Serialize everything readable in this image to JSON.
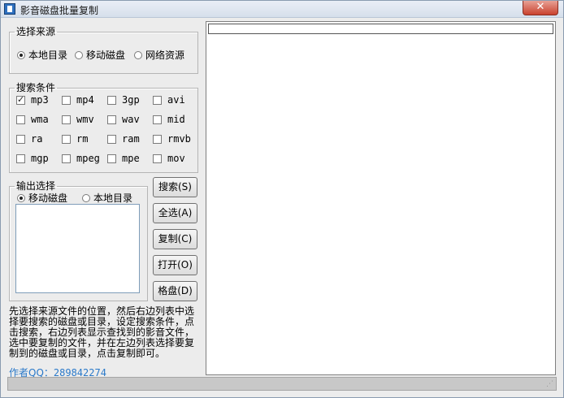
{
  "window": {
    "title": "影音磁盘批量复制",
    "close_glyph": "✕"
  },
  "source_group": {
    "legend": "选择来源",
    "options": [
      {
        "label": "本地目录",
        "selected": true
      },
      {
        "label": "移动磁盘",
        "selected": false
      },
      {
        "label": "网络资源",
        "selected": false
      }
    ]
  },
  "search_group": {
    "legend": "搜索条件",
    "types": [
      {
        "label": "mp3",
        "checked": true
      },
      {
        "label": "mp4",
        "checked": false
      },
      {
        "label": "3gp",
        "checked": false
      },
      {
        "label": "avi",
        "checked": false
      },
      {
        "label": "wma",
        "checked": false
      },
      {
        "label": "wmv",
        "checked": false
      },
      {
        "label": "wav",
        "checked": false
      },
      {
        "label": "mid",
        "checked": false
      },
      {
        "label": "ra",
        "checked": false
      },
      {
        "label": "rm",
        "checked": false
      },
      {
        "label": "ram",
        "checked": false
      },
      {
        "label": "rmvb",
        "checked": false
      },
      {
        "label": "mgp",
        "checked": false
      },
      {
        "label": "mpeg",
        "checked": false
      },
      {
        "label": "mpe",
        "checked": false
      },
      {
        "label": "mov",
        "checked": false
      }
    ]
  },
  "output_group": {
    "legend": "输出选择",
    "options": [
      {
        "label": "移动磁盘",
        "selected": true
      },
      {
        "label": "本地目录",
        "selected": false
      }
    ]
  },
  "buttons": {
    "search": "搜索(S)",
    "select_all": "全选(A)",
    "copy": "复制(C)",
    "open": "打开(O)",
    "format": "格盘(D)"
  },
  "hint": "先选择来源文件的位置，然后右边列表中选择要搜索的磁盘或目录，设定搜索条件，点击搜索，右边列表显示查找到的影音文件，选中要复制的文件，并在左边列表选择要复制到的磁盘或目录，点击复制即可。",
  "author": {
    "label": "作者QQ：",
    "qq": "289842274"
  },
  "colors": {
    "author_text": "#2a79c9",
    "close_button": "#c9422e"
  }
}
